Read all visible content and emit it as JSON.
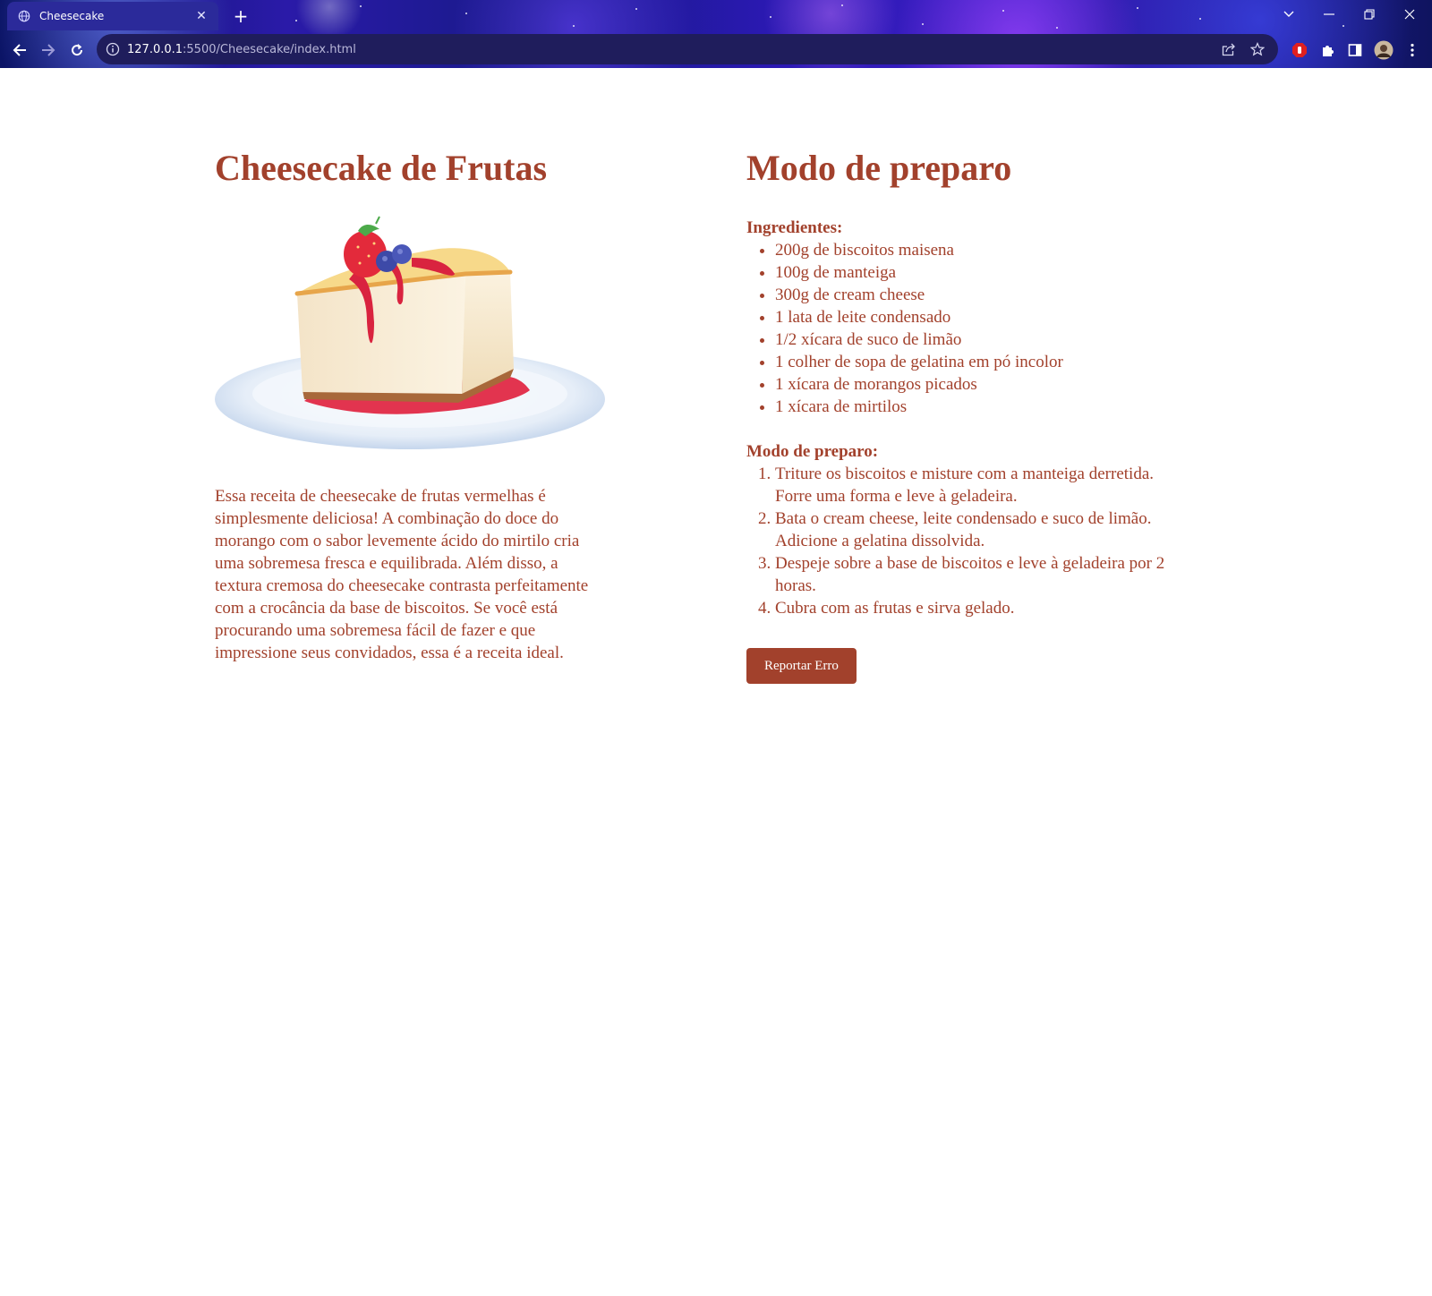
{
  "browser": {
    "tab_title": "Cheesecake",
    "url_host": "127.0.0.1",
    "url_path": ":5500/Cheesecake/index.html"
  },
  "left": {
    "title": "Cheesecake de Frutas",
    "description": "Essa receita de cheesecake de frutas vermelhas é simplesmente deliciosa! A combinação do doce do morango com o sabor levemente ácido do mirtilo cria uma sobremesa fresca e equilibrada. Além disso, a textura cremosa do cheesecake contrasta perfeitamente com a crocância da base de biscoitos. Se você está procurando uma sobremesa fácil de fazer e que impressione seus convidados, essa é a receita ideal."
  },
  "right": {
    "title": "Modo de preparo",
    "ingredients_label": "Ingredientes:",
    "ingredients": [
      "200g de biscoitos maisena",
      "100g de manteiga",
      "300g de cream cheese",
      "1 lata de leite condensado",
      "1/2 xícara de suco de limão",
      "1 colher de sopa de gelatina em pó incolor",
      "1 xícara de morangos picados",
      "1 xícara de mirtilos"
    ],
    "steps_label": "Modo de preparo:",
    "steps": [
      "Triture os biscoitos e misture com a manteiga derretida. Forre uma forma e leve à geladeira.",
      "Bata o cream cheese, leite condensado e suco de limão. Adicione a gelatina dissolvida.",
      "Despeje sobre a base de biscoitos e leve à geladeira por 2 horas.",
      "Cubra com as frutas e sirva gelado."
    ],
    "report_button": "Reportar Erro"
  },
  "colors": {
    "accent": "#a2412c",
    "background": "#ffffff"
  }
}
